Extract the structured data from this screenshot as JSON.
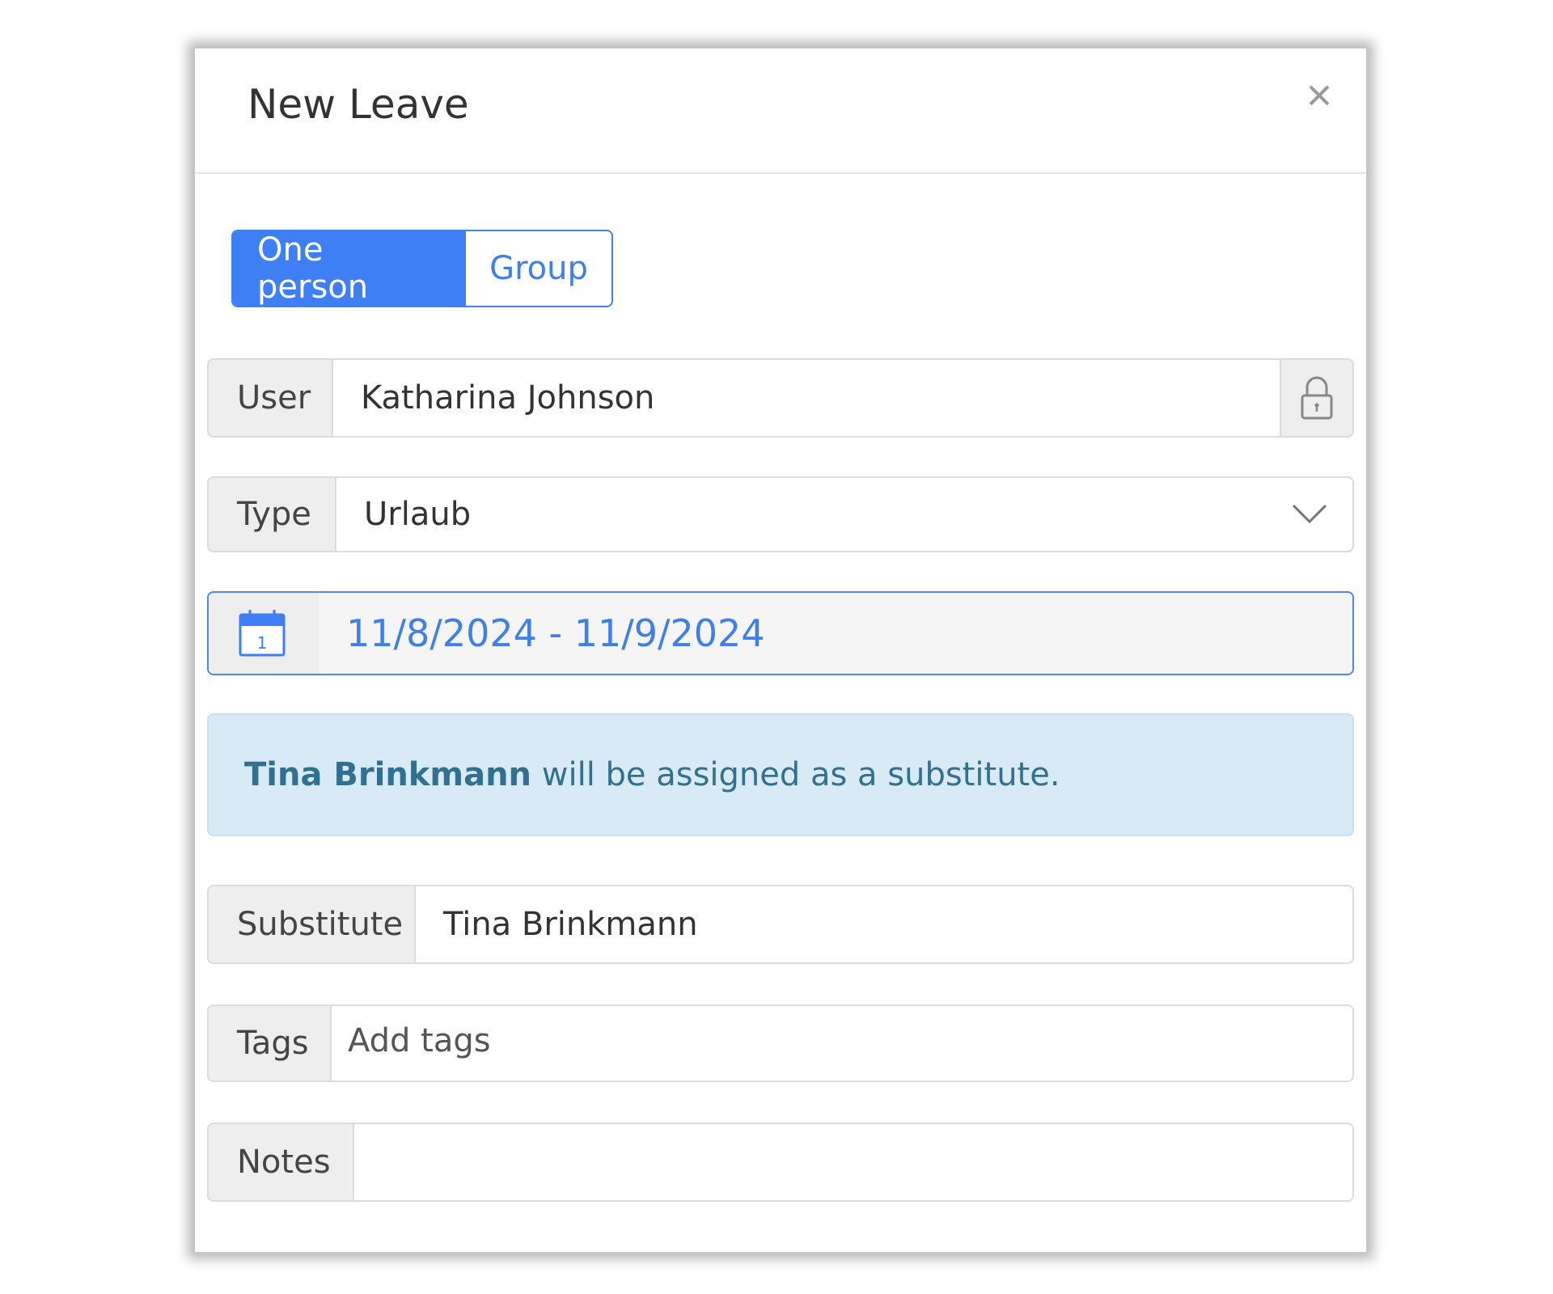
{
  "modal": {
    "title": "New Leave",
    "close_icon": "close-icon"
  },
  "mode_toggle": {
    "options": [
      "One person",
      "Group"
    ],
    "selected": "One person"
  },
  "fields": {
    "user": {
      "label": "User",
      "value": "Katharina Johnson",
      "icon": "lock-icon"
    },
    "type": {
      "label": "Type",
      "value": "Urlaub",
      "icon": "chevron-down-icon"
    },
    "date_range": {
      "value": "11/8/2024 - 11/9/2024",
      "icon": "calendar-icon",
      "calendar_day": "1"
    },
    "substitute": {
      "label": "Substitute",
      "value": "Tina Brinkmann"
    },
    "tags": {
      "label": "Tags",
      "placeholder": "Add tags"
    },
    "notes": {
      "label": "Notes",
      "value": ""
    }
  },
  "alert": {
    "name": "Tina Brinkmann",
    "message": " will be assigned as a substitute."
  },
  "colors": {
    "accent": "#3f7ff5",
    "alert_bg": "#d9eaf7",
    "alert_text": "#31708f"
  }
}
